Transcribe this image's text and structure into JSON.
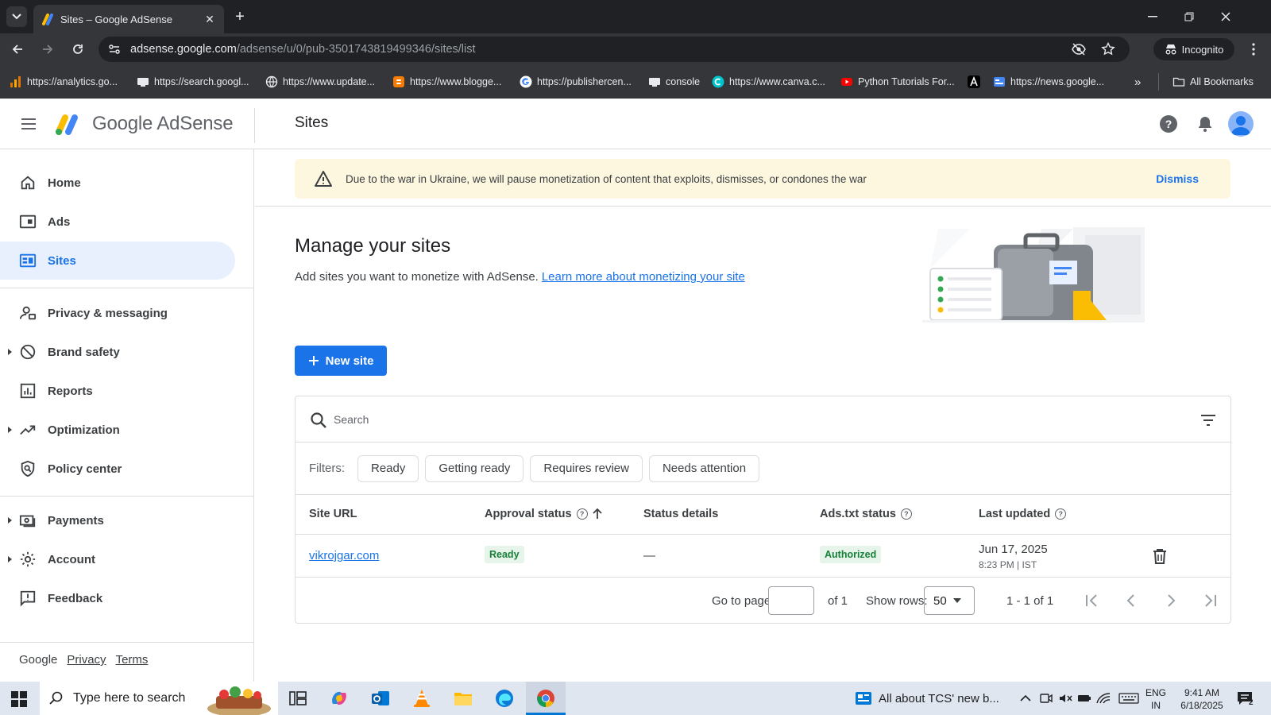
{
  "browser": {
    "tab_title": "Sites – Google AdSense",
    "url_host": "adsense.google.com",
    "url_path": "/adsense/u/0/pub-3501743819499346/sites/list",
    "incognito_label": "Incognito",
    "bookmarks": [
      "https://analytics.go...",
      "https://search.googl...",
      "https://www.update...",
      "https://www.blogge...",
      "https://publishercen...",
      "console",
      "https://www.canva.c...",
      "Python Tutorials For...",
      "https://news.google..."
    ],
    "all_bookmarks_label": "All Bookmarks"
  },
  "header": {
    "brand": "Google AdSense",
    "page_title": "Sites"
  },
  "sidebar": {
    "items": [
      {
        "label": "Home"
      },
      {
        "label": "Ads"
      },
      {
        "label": "Sites"
      },
      {
        "label": "Privacy & messaging"
      },
      {
        "label": "Brand safety"
      },
      {
        "label": "Reports"
      },
      {
        "label": "Optimization"
      },
      {
        "label": "Policy center"
      },
      {
        "label": "Payments"
      },
      {
        "label": "Account"
      },
      {
        "label": "Feedback"
      }
    ],
    "footer": {
      "google": "Google",
      "privacy": "Privacy",
      "terms": "Terms"
    }
  },
  "banner": {
    "text": "Due to the war in Ukraine, we will pause monetization of content that exploits, dismisses, or condones the war",
    "dismiss": "Dismiss"
  },
  "manage": {
    "title": "Manage your sites",
    "description": "Add sites you want to monetize with AdSense.",
    "learn_more": "Learn more about monetizing your site",
    "new_site": "New site"
  },
  "table": {
    "search_placeholder": "Search",
    "filters_label": "Filters:",
    "filters": [
      "Ready",
      "Getting ready",
      "Requires review",
      "Needs attention"
    ],
    "columns": [
      "Site URL",
      "Approval status",
      "Status details",
      "Ads.txt status",
      "Last updated"
    ],
    "rows": [
      {
        "site_url": "vikrojgar.com",
        "approval_status": "Ready",
        "status_details": "—",
        "ads_txt_status": "Authorized",
        "last_updated_date": "Jun 17, 2025",
        "last_updated_time": "8:23 PM | IST"
      }
    ],
    "pagination": {
      "go_to_page_label": "Go to page:",
      "of_pages": "of 1",
      "show_rows_label": "Show rows:",
      "rows_per_page": "50",
      "range_text": "1 - 1 of 1"
    }
  },
  "taskbar": {
    "search_placeholder": "Type here to search",
    "news_text": "All about TCS' new b...",
    "lang_line1": "ENG",
    "lang_line2": "IN",
    "time": "9:41 AM",
    "date": "6/18/2025",
    "notification_count": "2"
  },
  "colors": {
    "accent": "#1a73e8",
    "active_nav_bg": "#e8f0fe",
    "banner_bg": "#fef7e0",
    "ready_badge_bg": "#e6f4ea",
    "ready_badge_text": "#188038"
  }
}
